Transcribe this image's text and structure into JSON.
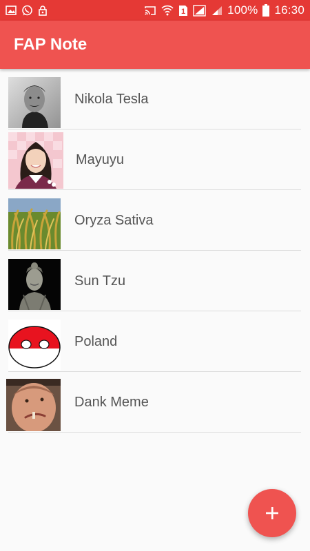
{
  "status_bar": {
    "battery": "100%",
    "time": "16:30",
    "sim_badge": "1",
    "icons_left": [
      "image-icon",
      "whatsapp-icon",
      "lock-icon"
    ],
    "icons_right": [
      "cast-icon",
      "wifi-icon",
      "sim-icon",
      "signal-icon",
      "battery-icon"
    ]
  },
  "app_bar": {
    "title": "FAP Note"
  },
  "items": [
    {
      "name": "Nikola Tesla",
      "thumbnail": "portrait-photo"
    },
    {
      "name": "Mayuyu",
      "thumbnail": "portrait-photo"
    },
    {
      "name": "Oryza Sativa",
      "thumbnail": "rice-plant-photo"
    },
    {
      "name": "Sun Tzu",
      "thumbnail": "statue-photo"
    },
    {
      "name": "Poland",
      "thumbnail": "polandball-drawing"
    },
    {
      "name": "Dank Meme",
      "thumbnail": "face-photo"
    }
  ],
  "fab": {
    "icon": "plus-icon"
  },
  "colors": {
    "status_bar": "#e53935",
    "app_bar": "#ef5350",
    "fab": "#ef5350",
    "background": "#fafafa"
  }
}
